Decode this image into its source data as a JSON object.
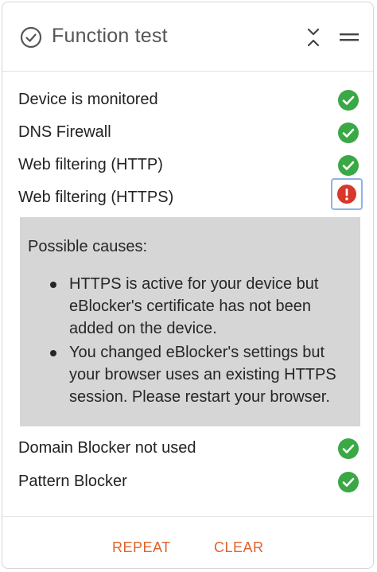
{
  "header": {
    "title": "Function test",
    "title_icon": "check-circle-icon",
    "collapse_icon": "collapse-icon",
    "menu_icon": "menu-icon"
  },
  "checks": [
    {
      "label": "Device is monitored",
      "status": "ok"
    },
    {
      "label": "DNS Firewall",
      "status": "ok"
    },
    {
      "label": "Web filtering (HTTP)",
      "status": "ok"
    },
    {
      "label": "Web filtering (HTTPS)",
      "status": "error"
    },
    {
      "label": "Domain Blocker not used",
      "status": "ok"
    },
    {
      "label": "Pattern Blocker",
      "status": "ok"
    }
  ],
  "causes": {
    "title": "Possible causes:",
    "items": [
      "HTTPS is active for your device but eBlocker's certificate has not been added on the device.",
      "You changed eBlocker's settings but your browser uses an existing HTTPS session. Please restart your browser."
    ]
  },
  "footer": {
    "repeat_label": "REPEAT",
    "clear_label": "CLEAR"
  },
  "colors": {
    "ok": "#3aa845",
    "error": "#d8372b",
    "accent": "#e0632a",
    "causes_bg": "#d6d6d6"
  }
}
